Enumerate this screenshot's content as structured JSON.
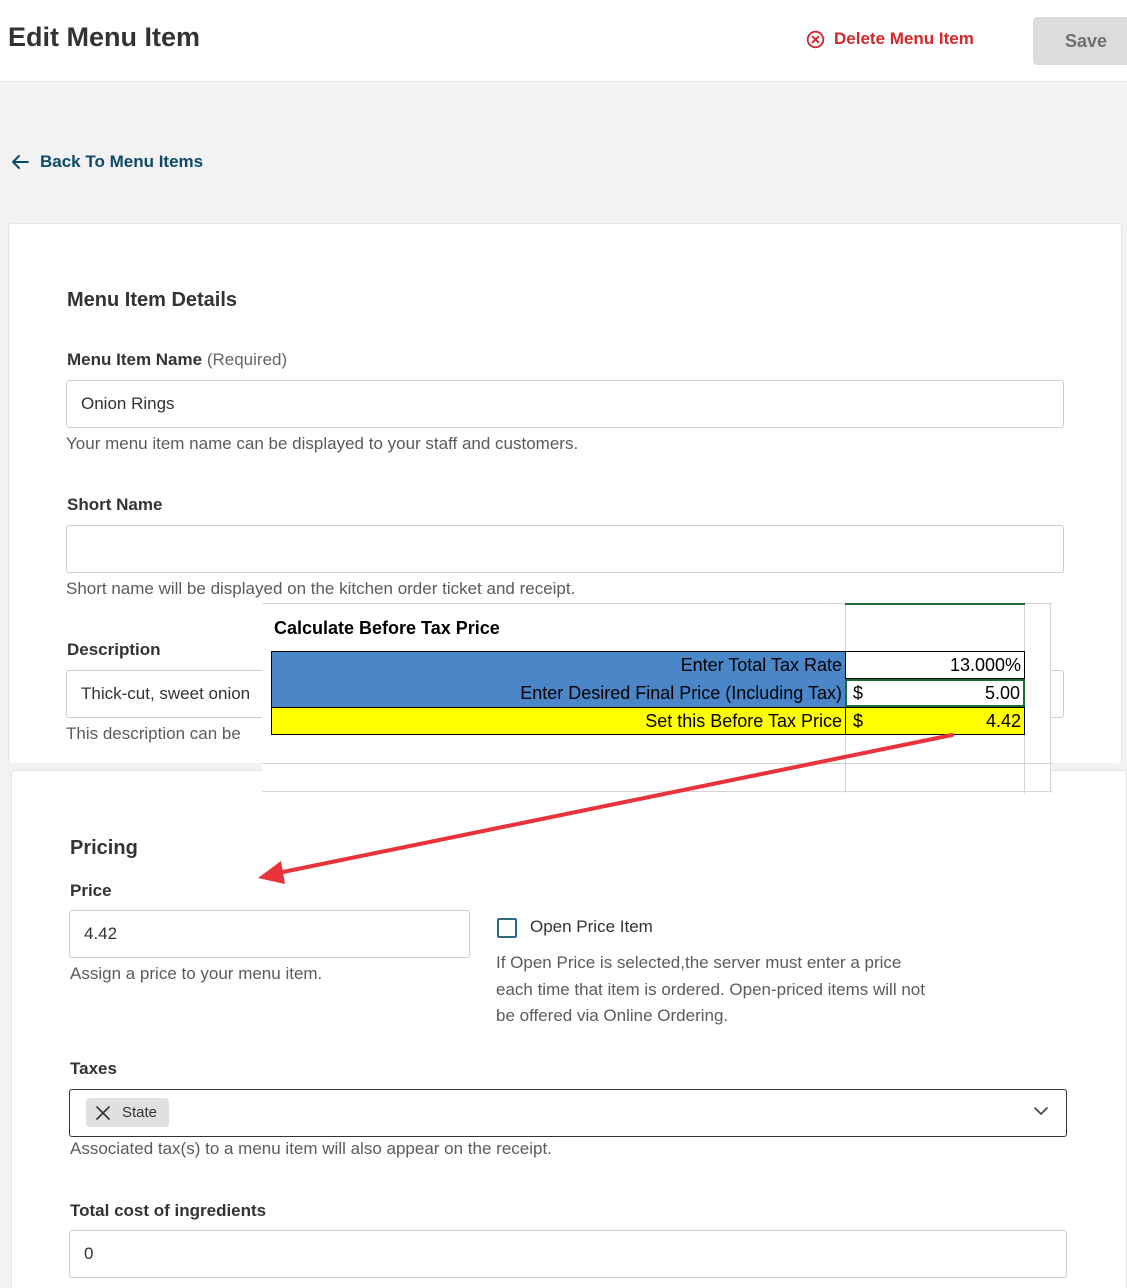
{
  "header": {
    "title": "Edit Menu Item",
    "delete_label": "Delete Menu Item",
    "save_label": "Save"
  },
  "nav": {
    "back_label": "Back To Menu Items"
  },
  "details": {
    "section_title": "Menu Item Details",
    "name": {
      "label": "Menu Item Name",
      "required": "(Required)",
      "value": "Onion Rings",
      "help": "Your menu item name can be displayed to your staff and customers."
    },
    "short_name": {
      "label": "Short Name",
      "value": "",
      "help": "Short name will be displayed on the kitchen order ticket and receipt."
    },
    "description": {
      "label": "Description",
      "value": "Thick-cut, sweet onion",
      "help": "This description can be"
    }
  },
  "spreadsheet": {
    "title": "Calculate Before Tax Price",
    "rows": [
      {
        "label": "Enter Total Tax Rate",
        "currency": "",
        "value": "13.000%"
      },
      {
        "label": "Enter Desired Final Price (Including Tax)",
        "currency": "$",
        "value": "5.00"
      },
      {
        "label": "Set this Before Tax Price",
        "currency": "$",
        "value": "4.42"
      }
    ],
    "colors": {
      "header_fill": "#4a86c8",
      "result_fill": "#ffff00",
      "arrow": "#e8333b"
    }
  },
  "pricing": {
    "section_title": "Pricing",
    "price": {
      "label": "Price",
      "value": "4.42",
      "help": "Assign a price to your menu item."
    },
    "open_price": {
      "label": "Open Price Item",
      "checked": false,
      "help_lines": [
        "If Open Price is selected,the server must enter a price",
        "each time that item is ordered. Open-priced items will not",
        "be offered via Online Ordering."
      ]
    },
    "taxes": {
      "label": "Taxes",
      "chips": [
        "State"
      ],
      "help": "Associated tax(s) to a menu item will also appear on the receipt."
    },
    "cost": {
      "label": "Total cost of ingredients",
      "value": "0"
    }
  },
  "icons": {
    "delete": "circle-x-icon",
    "back": "arrow-left-icon",
    "chip_remove": "close-icon",
    "dropdown": "chevron-down-icon"
  }
}
